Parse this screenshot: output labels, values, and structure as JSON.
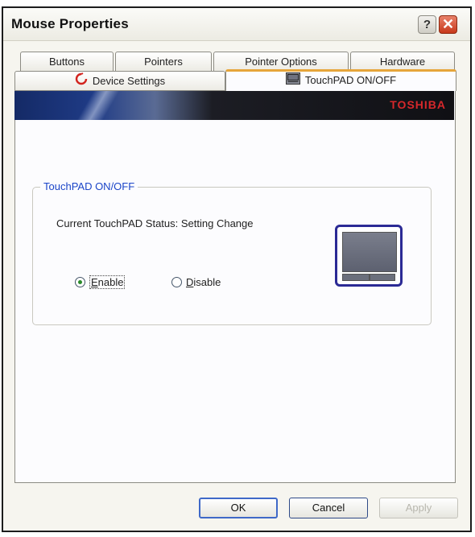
{
  "window": {
    "title": "Mouse Properties",
    "help_glyph": "?",
    "close_glyph": "✕"
  },
  "tabs_row1": [
    "Buttons",
    "Pointers",
    "Pointer Options",
    "Hardware"
  ],
  "tabs_row2": [
    {
      "label": "Device Settings",
      "icon": "device-settings-icon"
    },
    {
      "label": "TouchPAD ON/OFF",
      "icon": "touchpad-icon"
    }
  ],
  "banner": {
    "brand": "TOSHIBA",
    "brand_color": "#d6282b"
  },
  "group": {
    "label": "TouchPAD ON/OFF",
    "status_text": "Current TouchPAD Status: Setting Change",
    "enable": {
      "label": "Enable",
      "underline": "E",
      "rest": "nable",
      "checked": true
    },
    "disable": {
      "label": "Disable",
      "underline": "D",
      "rest": "isable",
      "checked": false
    }
  },
  "buttons": {
    "ok": "OK",
    "cancel": "Cancel",
    "apply": "Apply"
  }
}
